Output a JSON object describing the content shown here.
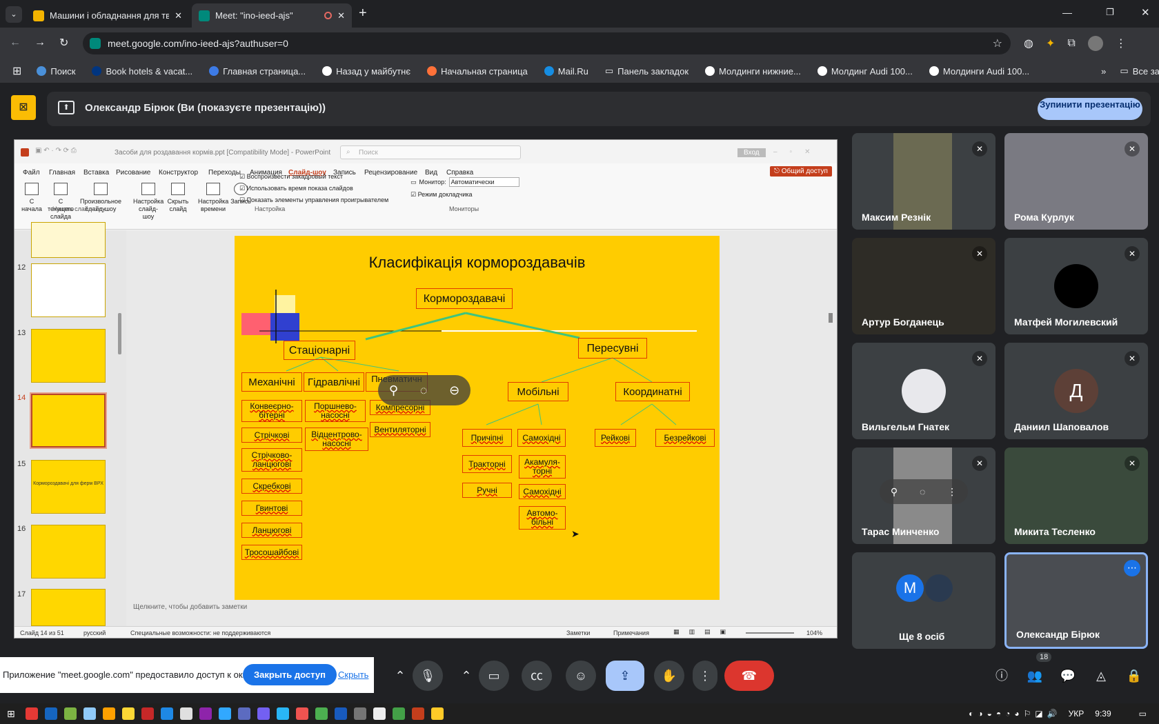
{
  "browser": {
    "tabs": [
      {
        "title": "Машини і обладнання для тва",
        "favicon_color": "#f4b400"
      },
      {
        "title": "Meet: \"ino-ieed-ajs\"",
        "favicon_color": "#00897b"
      }
    ],
    "url": "meet.google.com/ino-ieed-ajs?authuser=0",
    "bookmarks": [
      {
        "label": "Поиск",
        "color": "#4a90d9"
      },
      {
        "label": "Book hotels & vacat...",
        "color": "#003580"
      },
      {
        "label": "Главная страница...",
        "color": "#3d7be6"
      },
      {
        "label": "Назад у майбутнє",
        "color": "#ffffff"
      },
      {
        "label": "Начальная страница",
        "color": "#ff7139"
      },
      {
        "label": "Mail.Ru",
        "color": "#168de2"
      },
      {
        "label": "Панель закладок",
        "color": "#9aa0a6"
      },
      {
        "label": "Молдинги нижние...",
        "color": "#ffffff"
      },
      {
        "label": "Молдинг Audi 100...",
        "color": "#ffffff"
      },
      {
        "label": "Молдинги Audi 100...",
        "color": "#ffffff"
      }
    ],
    "all_bookmarks": "Все закладки"
  },
  "meet": {
    "presenting_text": "Олександр Бірюк (Ви (показуєте презентацію))",
    "stop_button": "Зупинити презентацію",
    "participants": [
      {
        "name": "Максим Резнік",
        "bg": "#6b6a52"
      },
      {
        "name": "Рома Курлук",
        "bg": "#7a7a82"
      },
      {
        "name": "Артур Богданець",
        "bg": "#2e2c26"
      },
      {
        "name": "Матфей Могилевский",
        "bg": "#3c4043"
      },
      {
        "name": "Вильгельм Гнатек",
        "bg": "#3c4043"
      },
      {
        "name": "Даниил Шаповалов",
        "bg": "#3c4043"
      },
      {
        "name": "Тарас Минченко",
        "bg": "#3c4043"
      },
      {
        "name": "Микита Тесленко",
        "bg": "#3a4a3c"
      },
      {
        "name": "Ще 8 осіб",
        "bg": "#3c4043"
      },
      {
        "name": "Олександр Бірюк",
        "bg": "#4a4d52"
      }
    ],
    "avatar_letter": "Д",
    "avatar_letter_m": "M",
    "people_count": "18",
    "share_banner_text": "Приложение \"meet.google.com\" предоставило доступ к окну.",
    "close_access": "Закрыть доступ",
    "hide": "Скрыть"
  },
  "ppt": {
    "title": "Засоби для роздавання кормів.ppt [Compatibility Mode] - PowerPoint",
    "search": "Поиск",
    "login": "Вход",
    "share": "Общий доступ",
    "tabs": [
      "Файл",
      "Главная",
      "Вставка",
      "Рисование",
      "Конструктор",
      "Переходы",
      "Анимация",
      "Слайд-шоу",
      "Запись",
      "Рецензирование",
      "Вид",
      "Справка"
    ],
    "ribbon": {
      "btn_start": "С начала",
      "btn_current": "С текущего слайда",
      "btn_custom": "Произвольное слайд-шоу",
      "btn_setup": "Настройка слайд-шоу",
      "btn_hide": "Скрыть слайд",
      "btn_timing": "Настройка времени",
      "btn_record": "Запись",
      "chk1": "Воспроизвести закадровый текст",
      "chk2": "Использовать время показа слайдов",
      "chk3": "Показать элементы управления проигрывателем",
      "monitor_label": "Монитор:",
      "monitor_value": "Автоматически",
      "presenter": "Режим докладчика",
      "group1": "Начать слайд-шоу",
      "group2": "Настройка",
      "group3": "Мониторы"
    },
    "thumb_numbers": [
      "12",
      "13",
      "14",
      "15",
      "16",
      "17"
    ],
    "thumb15_text": "Кормороздавачі для ферм ВРХ",
    "notes": "Щелкните, чтобы добавить заметки",
    "status_slide": "Слайд 14 из 51",
    "status_lang": "русский",
    "status_access": "Специальные возможности: не поддерживаются",
    "status_notes": "Заметки",
    "status_comments": "Примечания",
    "zoom": "104%"
  },
  "slide": {
    "title": "Класифікація кормороздавачів",
    "root": "Кормороздавачі",
    "stationary": "Стаціонарні",
    "mobile_group": "Пересувні",
    "mech": "Механічні",
    "hydr": "Гідравлічні",
    "pneu": "Пневматичн",
    "mech_items": [
      "Конвеєрно-бітерні",
      "Стрічкові",
      "Стрічково-ланцюгові",
      "Скребкові",
      "Гвинтові",
      "Ланцюгові",
      "Тросошайбові"
    ],
    "hydr_items": [
      "Поршнево-насосні",
      "Відцентрово-насосні"
    ],
    "pneu_items": [
      "Компресорні",
      "Вентиляторні"
    ],
    "mobile": "Мобільні",
    "coord": "Координатні",
    "mobile_left": [
      "Причіпні",
      "Тракторні",
      "Ручні"
    ],
    "mobile_right": [
      "Самохідні",
      "Акамуля-торні",
      "Самохідні",
      "Автомо-більні"
    ],
    "coord_items": [
      "Рейкові",
      "Безрейкові"
    ]
  },
  "taskbar": {
    "lang": "УКР",
    "time": "9:39"
  }
}
